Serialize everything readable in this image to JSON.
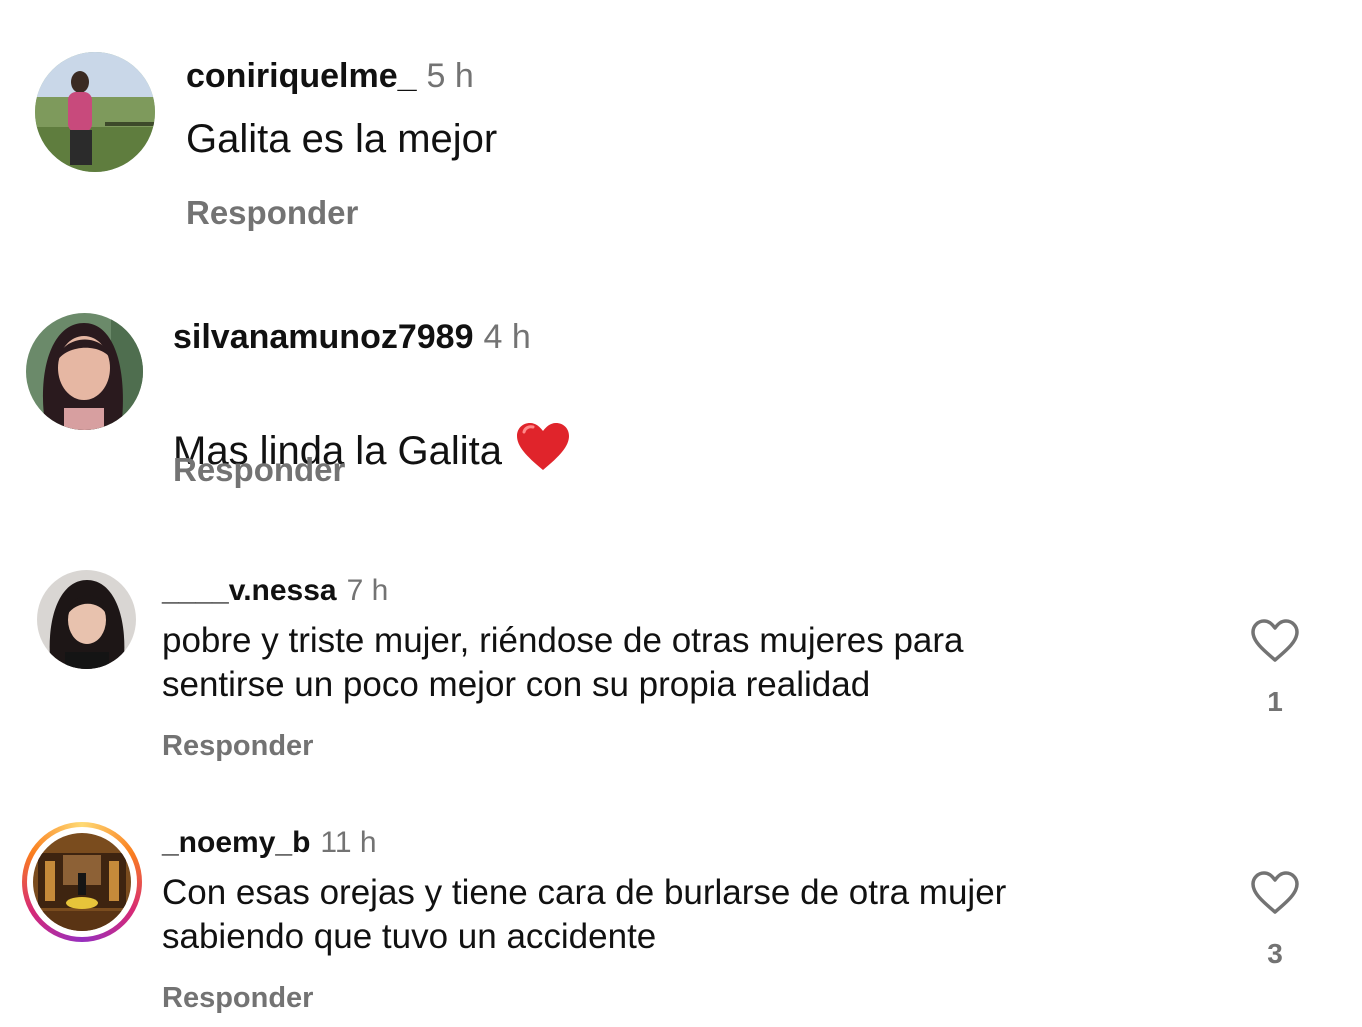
{
  "colors": {
    "text": "#111111",
    "secondary": "#737373",
    "heart_emoji": "#e0242b"
  },
  "comments": [
    {
      "username": "coniriquelme_",
      "time": "5 h",
      "text": "Galita es la mejor",
      "reply_label": "Responder"
    },
    {
      "username": "silvanamunoz7989",
      "time": "4 h",
      "text": "Mas linda la Galita",
      "emoji": "red-heart-icon",
      "reply_label": "Responder"
    },
    {
      "username": "____v.nessa",
      "time": "7 h",
      "text": "pobre y triste mujer, riéndose de otras mujeres para\nsentirse un poco mejor con su propia realidad",
      "reply_label": "Responder",
      "like_count": "1"
    },
    {
      "username": "_noemy_b",
      "time": "11 h",
      "text": "Con esas orejas y tiene cara de burlarse de otra mujer\nsabiendo que tuvo un accidente",
      "reply_label": "Responder",
      "like_count": "3",
      "has_story": true
    }
  ]
}
